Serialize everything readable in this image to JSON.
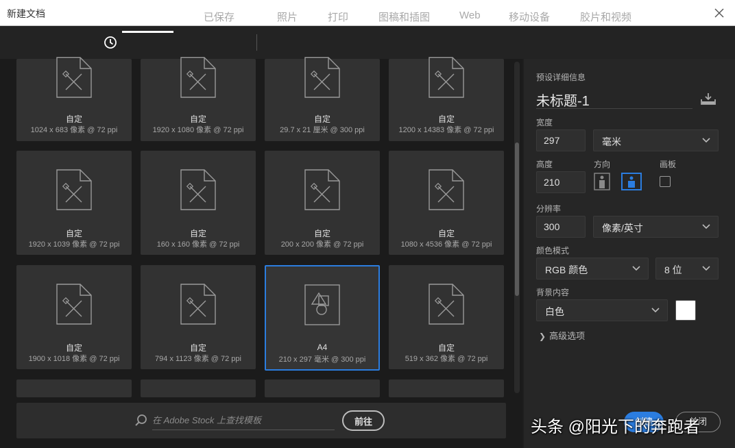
{
  "window": {
    "title": "新建文档"
  },
  "tabs": [
    {
      "label": "最近使用项",
      "active": true
    },
    {
      "label": "已保存"
    },
    {
      "label": "照片"
    },
    {
      "label": "打印"
    },
    {
      "label": "图稿和插图"
    },
    {
      "label": "Web"
    },
    {
      "label": "移动设备"
    },
    {
      "label": "胶片和视频"
    }
  ],
  "presets": [
    {
      "name": "自定",
      "size": "1024 x 683 像素 @ 72 ppi"
    },
    {
      "name": "自定",
      "size": "1920 x 1080 像素 @ 72 ppi"
    },
    {
      "name": "自定",
      "size": "29.7 x 21 厘米 @ 300 ppi"
    },
    {
      "name": "自定",
      "size": "1200 x 14383 像素 @ 72 ppi"
    },
    {
      "name": "自定",
      "size": "1920 x 1039 像素 @ 72 ppi"
    },
    {
      "name": "自定",
      "size": "160 x 160 像素 @ 72 ppi"
    },
    {
      "name": "自定",
      "size": "200 x 200 像素 @ 72 ppi"
    },
    {
      "name": "自定",
      "size": "1080 x 4536 像素 @ 72 ppi"
    },
    {
      "name": "自定",
      "size": "1900 x 1018 像素 @ 72 ppi"
    },
    {
      "name": "自定",
      "size": "794 x 1123 像素 @ 72 ppi"
    },
    {
      "name": "A4",
      "size": "210 x 297 毫米 @ 300 ppi",
      "selected": true
    },
    {
      "name": "自定",
      "size": "519 x 362 像素 @ 72 ppi"
    }
  ],
  "stock": {
    "placeholder": "在 Adobe Stock 上查找模板",
    "go_label": "前往"
  },
  "details": {
    "section_label": "预设详细信息",
    "doc_title": "未标题-1",
    "width_label": "宽度",
    "width_value": "297",
    "width_unit": "毫米",
    "height_label": "高度",
    "height_value": "210",
    "orientation_label": "方向",
    "artboard_label": "画板",
    "resolution_label": "分辨率",
    "resolution_value": "300",
    "resolution_unit": "像素/英寸",
    "color_mode_label": "颜色模式",
    "color_mode": "RGB 颜色",
    "bit_depth": "8 位",
    "background_label": "背景内容",
    "background": "白色",
    "background_color": "#ffffff",
    "advanced_label": "高级选项"
  },
  "footer": {
    "create_label": "创建",
    "close_label": "关闭"
  },
  "watermark": "头条 @阳光下的奔跑者",
  "colors": {
    "accent": "#2b7de0",
    "card": "#323232",
    "panel": "#262626"
  }
}
